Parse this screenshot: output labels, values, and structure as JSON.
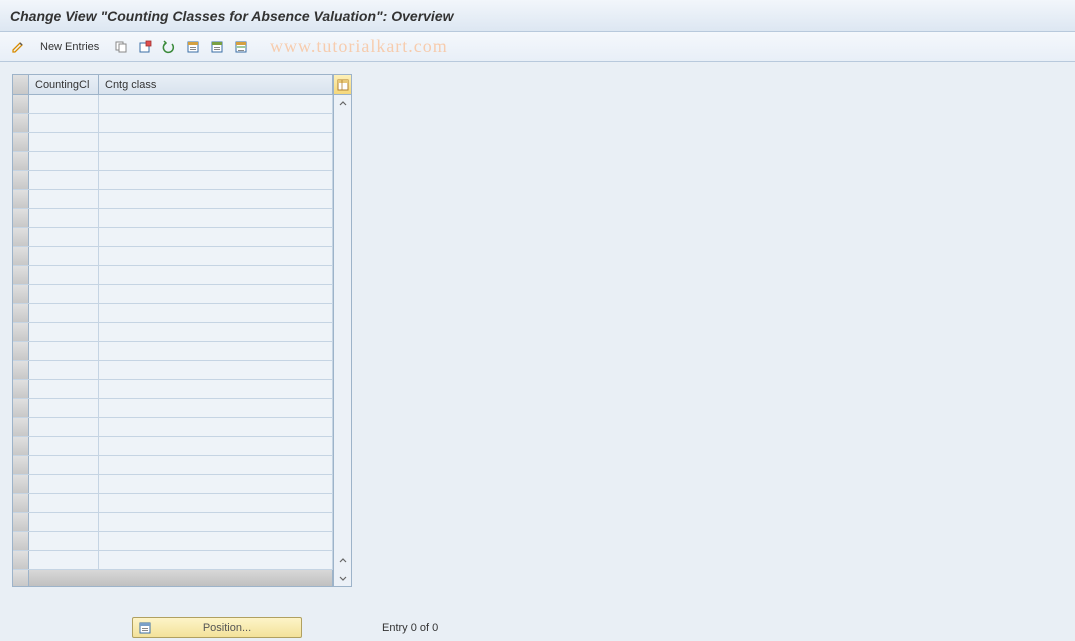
{
  "header": {
    "title": "Change View \"Counting Classes for Absence Valuation\": Overview"
  },
  "toolbar": {
    "new_entries_label": "New Entries",
    "watermark": "www.tutorialkart.com"
  },
  "table": {
    "columns": [
      "CountingCl",
      "Cntg class"
    ],
    "row_count": 25
  },
  "footer": {
    "position_label": "Position...",
    "entry_text": "Entry 0 of 0"
  }
}
